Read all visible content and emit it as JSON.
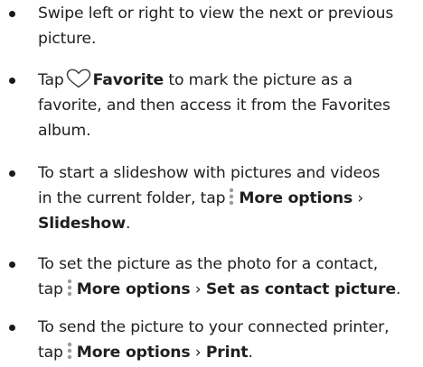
{
  "items": [
    {
      "line1": "Swipe left or right to view the next or previous",
      "line2": "picture."
    },
    {
      "pre": "Tap",
      "icon": "heart-outline-icon",
      "bold": "Favorite",
      "line1_rest": " to mark the picture as a",
      "line2": "favorite, and then access it from the Favorites",
      "line3": "album."
    },
    {
      "line1": "To start a slideshow with pictures and videos",
      "line2_pre": "in the current folder, tap",
      "icon": "more-options-icon",
      "bold1": "More options",
      "sep": " ›",
      "bold2": "Slideshow",
      "end": "."
    },
    {
      "line1": "To set the picture as the photo for a contact,",
      "pre": "tap",
      "icon": "more-options-icon",
      "bold1": "More options",
      "sep": " › ",
      "bold2": "Set as contact picture",
      "end": "."
    },
    {
      "line1": "To send the picture to your connected printer,",
      "pre": "tap",
      "icon": "more-options-icon",
      "bold1": "More options",
      "sep": " › ",
      "bold2": "Print",
      "end": "."
    }
  ]
}
